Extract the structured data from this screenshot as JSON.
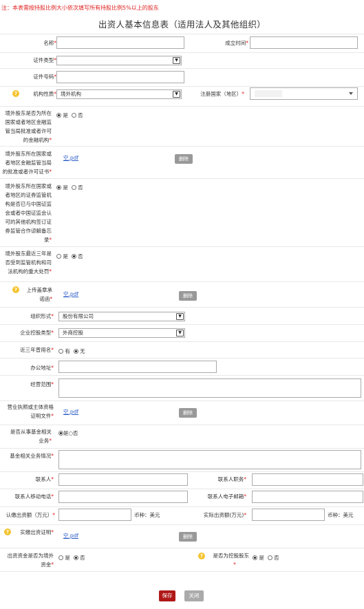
{
  "note": "注：本表需按持股比例大小依次填写所有持股比例5%以上的股东",
  "title": "出资人基本信息表（适用法人及其他组织）",
  "labels": {
    "name": "名称",
    "established": "成立时间",
    "id_type": "证件类型",
    "id_number": "证件号码",
    "org_nature": "机构性质",
    "reg_country": "注册国家（地区）",
    "q_licensed": [
      "境外股东是否为所在",
      "国家或者地区金融监",
      "管当局批准或者许可",
      "的金融机构"
    ],
    "q_approval": [
      "境外股东所在国家或",
      "者地区金融监管当局",
      "的批准或者许可证书"
    ],
    "q_mou": [
      "境外股东所在国家或",
      "者地区的证券监管机",
      "构是否已与中国证监",
      "会或者中国证监会认",
      "可的其他机构签订证",
      "券监管合作谅解备忘",
      "录"
    ],
    "q_penalty": [
      "境外股东最近三年是",
      "否受到监管机构和司",
      "法机构的重大处罚"
    ],
    "upload_commit": [
      "上传盖章承",
      "诺函"
    ],
    "org_form": "组织形式",
    "holding_type": "企业控股类型",
    "former_name": "近三年曾用名",
    "office_addr": "办公地址",
    "biz_scope": "经营范围",
    "biz_license": [
      "营业执照或主体资格",
      "证明文件"
    ],
    "q_fund": [
      "是否从事基金相关",
      "业务"
    ],
    "fund_desc": "基金相关业务情况",
    "contact": "联系人",
    "contact_title": "联系人职务",
    "contact_phone": "联系人移动电话",
    "contact_email": "联系人电子邮箱",
    "subscribed": "认缴出资额（万元）",
    "paid": "实际出资额(万元)",
    "paid_proof": "实缴出资证明",
    "q_overseas_capital": [
      "出资资金是否为境外",
      "资金"
    ],
    "q_controlling": "是否为控股股东"
  },
  "values": {
    "org_nature": "境外机构",
    "org_form": "股份有限公司",
    "holding_type": "外商控股",
    "currency1": "币种：美元",
    "currency2": "币种：美元"
  },
  "files": {
    "approval": "空.pdf",
    "commit": "空.pdf",
    "license": "空.pdf",
    "proof": "空.pdf"
  },
  "radio": {
    "yes": "是",
    "no": "否",
    "have": "有",
    "none": "无",
    "yes_no_compact": "是○否"
  },
  "buttons": {
    "delete": "删除",
    "save": "保存",
    "close": "关闭"
  },
  "icons": {
    "help": "question-mark-circle",
    "dropdown": "chevron-down-icon"
  },
  "colors": {
    "required": "#e02020",
    "save": "#b01818",
    "link": "#2a5cc7",
    "help": "#f4c430"
  }
}
